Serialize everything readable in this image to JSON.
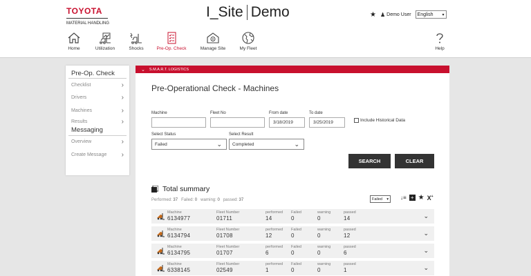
{
  "header": {
    "brand": "TOYOTA",
    "brand_sub": "MATERIAL HANDLING",
    "app_title_left": "I_Site",
    "app_title_right": "Demo",
    "user_name": "Demo User",
    "language": "English"
  },
  "nav": [
    {
      "label": "Home",
      "icon": "home-icon"
    },
    {
      "label": "Utilization",
      "icon": "forklift-chart-icon"
    },
    {
      "label": "Shocks",
      "icon": "forklift-shock-icon"
    },
    {
      "label": "Pre-Op. Check",
      "icon": "checklist-icon",
      "active": true
    },
    {
      "label": "Manage Site",
      "icon": "manage-site-icon"
    },
    {
      "label": "My Fleet",
      "icon": "globe-icon"
    },
    {
      "label": "Help",
      "icon": "help-icon"
    }
  ],
  "sidebar": {
    "section1_title": "Pre-Op. Check",
    "section1_items": [
      "Checklist",
      "Drivers",
      "Machines",
      "Results"
    ],
    "section2_title": "Messaging",
    "section2_items": [
      "Overview",
      "Create Message"
    ]
  },
  "banner": "S.M.A.R.T. LOGISTICS",
  "page_title": "Pre-Operational Check - Machines",
  "filters": {
    "machine_label": "Machine",
    "machine_value": "",
    "fleet_label": "Fleet No",
    "fleet_value": "",
    "from_label": "From date",
    "from_value": "3/18/2019",
    "to_label": "To date",
    "to_value": "3/25/2019",
    "historical_label": "Include Historical Data",
    "status_label": "Select Status",
    "status_value": "Failed",
    "result_label": "Select Result",
    "result_value": "Completed",
    "search_label": "SEARCH",
    "clear_label": "CLEAR"
  },
  "summary": {
    "title": "Total summary",
    "performed_label": "Performed:",
    "performed": "37",
    "failed_label": "Failed:",
    "failed": "0",
    "warning_label": "warning:",
    "warning": "0",
    "passed_label": "passed:",
    "passed": "37",
    "filter_value": "Failed"
  },
  "columns": {
    "machine": "Machine",
    "fleet": "Fleet Number",
    "performed": "performed",
    "failed": "Failed",
    "warning": "warning",
    "passed": "passed"
  },
  "rows": [
    {
      "machine": "6134977",
      "fleet": "01711",
      "performed": "14",
      "failed": "0",
      "warning": "0",
      "passed": "14"
    },
    {
      "machine": "6134794",
      "fleet": "01708",
      "performed": "12",
      "failed": "0",
      "warning": "0",
      "passed": "12"
    },
    {
      "machine": "6134795",
      "fleet": "01707",
      "performed": "6",
      "failed": "0",
      "warning": "0",
      "passed": "6"
    },
    {
      "machine": "6338145",
      "fleet": "02549",
      "performed": "1",
      "failed": "0",
      "warning": "0",
      "passed": "1"
    }
  ],
  "colors": {
    "accent": "#c8102e",
    "button": "#333333",
    "row_bg": "#f0f0f0"
  }
}
